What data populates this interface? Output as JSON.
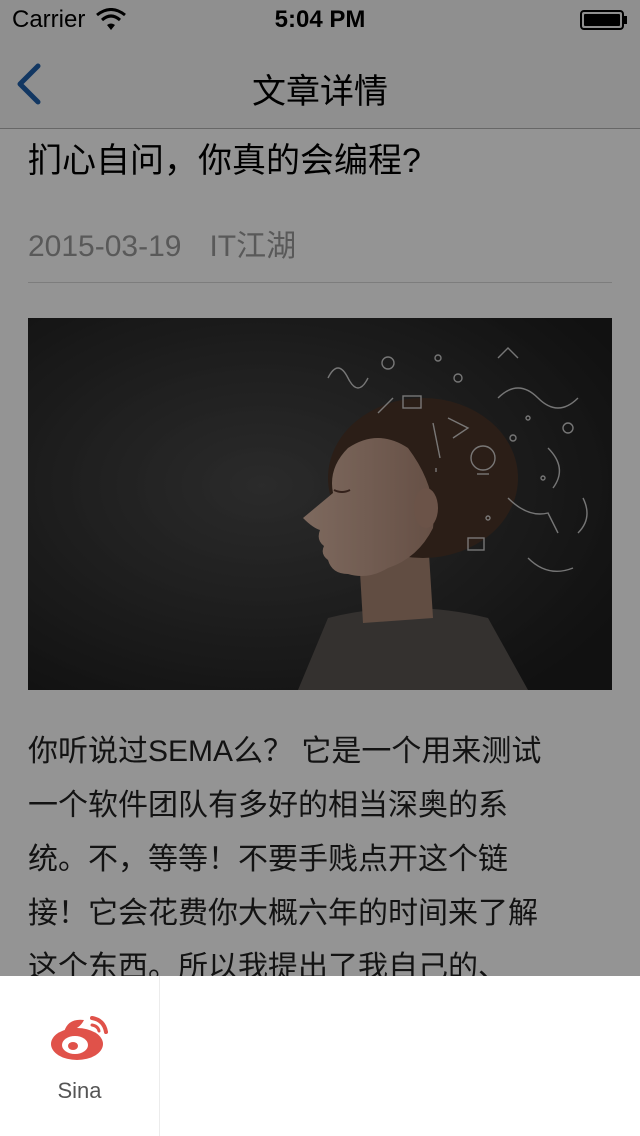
{
  "status_bar": {
    "carrier": "Carrier",
    "time": "5:04 PM"
  },
  "nav": {
    "title": "文章详情",
    "back_icon": "chevron-left-icon"
  },
  "article": {
    "title": "扪心自问，你真的会编程?",
    "date": "2015-03-19",
    "source": "IT江湖",
    "body_lines": [
      "你听说过SEMA么？ 它是一个用来测试",
      "一个软件团队有多好的相当深奥的系",
      "统。不，等等！不要手贱点开这个链",
      "接！它会花费你大概六年的时间来了解",
      "这个东西。所以我提出了我自己的、"
    ]
  },
  "share": {
    "items": [
      {
        "label": "Sina",
        "icon": "weibo-icon"
      }
    ]
  },
  "colors": {
    "nav_accent": "#1f5faa",
    "weibo_red": "#e0524a",
    "meta_gray": "#9a9a9a"
  }
}
